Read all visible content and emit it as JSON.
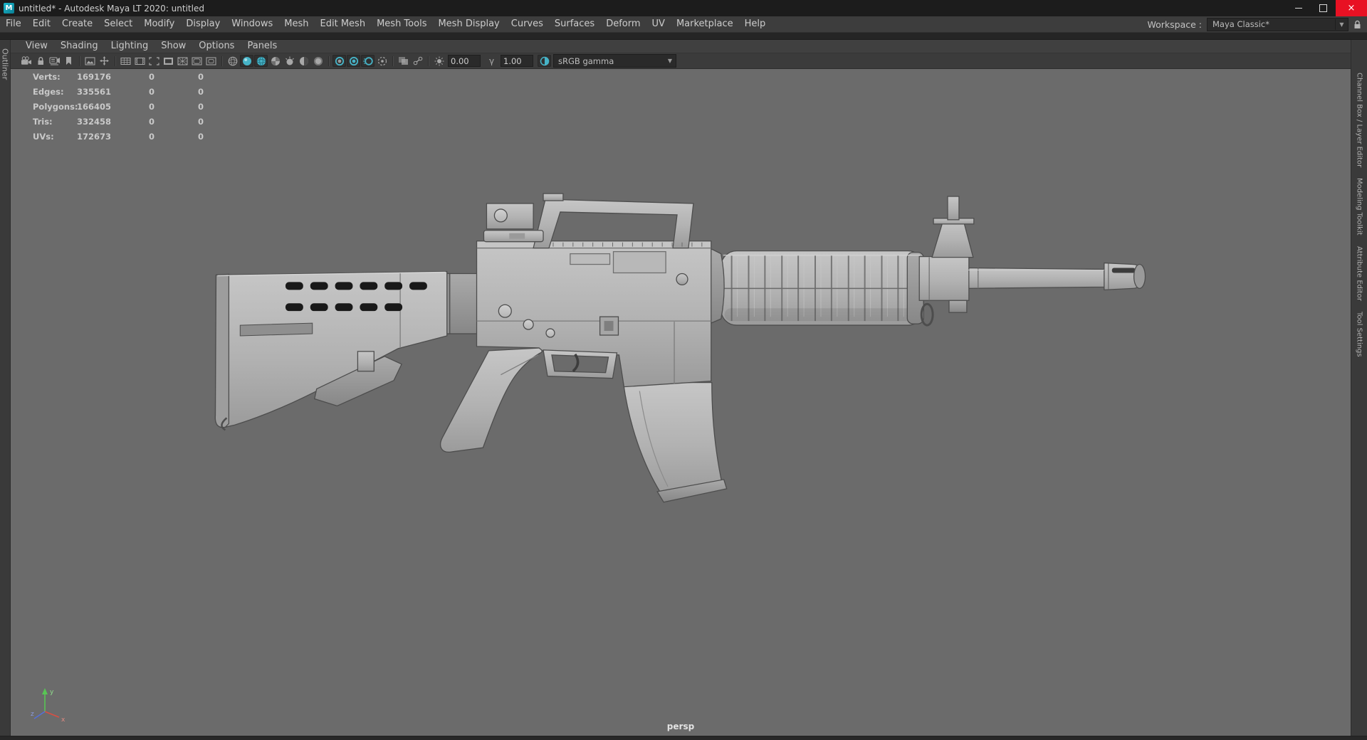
{
  "window": {
    "title": "untitled* - Autodesk Maya LT 2020: untitled",
    "logo_letter": "M",
    "close_glyph": "×"
  },
  "menubar": {
    "items": [
      "File",
      "Edit",
      "Create",
      "Select",
      "Modify",
      "Display",
      "Windows",
      "Mesh",
      "Edit Mesh",
      "Mesh Tools",
      "Mesh Display",
      "Curves",
      "Surfaces",
      "Deform",
      "UV",
      "Marketplace",
      "Help"
    ]
  },
  "workspace": {
    "label": "Workspace :",
    "value": "Maya Classic*"
  },
  "panel_menubar": {
    "items": [
      "View",
      "Shading",
      "Lighting",
      "Show",
      "Options",
      "Panels"
    ]
  },
  "panel_toolbar": {
    "exposure": "0.00",
    "gamma": "1.00",
    "view_transform": "sRGB gamma"
  },
  "hud": {
    "rows": [
      {
        "label": "Verts:",
        "total": "169176",
        "c2": "0",
        "c3": "0"
      },
      {
        "label": "Edges:",
        "total": "335561",
        "c2": "0",
        "c3": "0"
      },
      {
        "label": "Polygons:",
        "total": "166405",
        "c2": "0",
        "c3": "0"
      },
      {
        "label": "Tris:",
        "total": "332458",
        "c2": "0",
        "c3": "0"
      },
      {
        "label": "UVs:",
        "total": "172673",
        "c2": "0",
        "c3": "0"
      }
    ]
  },
  "side_tabs": {
    "left": [
      "Outliner"
    ],
    "right": [
      "Channel Box / Layer Editor",
      "Modeling Toolkit",
      "Attribute Editor",
      "Tool Settings"
    ]
  },
  "viewport": {
    "camera": "persp",
    "axis": {
      "x": "x",
      "y": "y",
      "z": "z"
    }
  },
  "icons": {
    "dropdown_arrow": "▼"
  },
  "colors": {
    "accent_teal": "#46b3c7",
    "viewport_bg": "#6b6b6b",
    "close_red": "#e81123"
  }
}
